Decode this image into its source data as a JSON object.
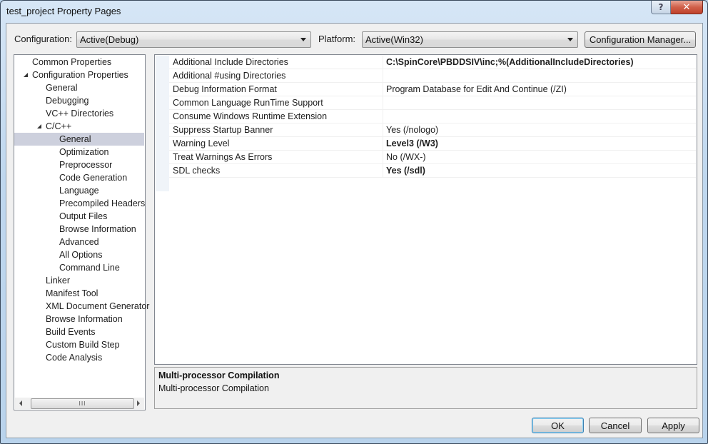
{
  "window": {
    "title": "test_project Property Pages",
    "help_button": "?",
    "close_button": "✕"
  },
  "toolbar": {
    "configuration_label": "Configuration:",
    "configuration_value": "Active(Debug)",
    "platform_label": "Platform:",
    "platform_value": "Active(Win32)",
    "config_manager_label": "Configuration Manager..."
  },
  "tree": {
    "items": [
      {
        "label": "Common Properties",
        "level": 0,
        "expander": "closed"
      },
      {
        "label": "Configuration Properties",
        "level": 0,
        "expander": "open"
      },
      {
        "label": "General",
        "level": 1,
        "expander": "none"
      },
      {
        "label": "Debugging",
        "level": 1,
        "expander": "none"
      },
      {
        "label": "VC++ Directories",
        "level": 1,
        "expander": "none"
      },
      {
        "label": "C/C++",
        "level": 1,
        "expander": "open"
      },
      {
        "label": "General",
        "level": 2,
        "expander": "none",
        "selected": true
      },
      {
        "label": "Optimization",
        "level": 2,
        "expander": "none"
      },
      {
        "label": "Preprocessor",
        "level": 2,
        "expander": "none"
      },
      {
        "label": "Code Generation",
        "level": 2,
        "expander": "none"
      },
      {
        "label": "Language",
        "level": 2,
        "expander": "none"
      },
      {
        "label": "Precompiled Headers",
        "level": 2,
        "expander": "none"
      },
      {
        "label": "Output Files",
        "level": 2,
        "expander": "none"
      },
      {
        "label": "Browse Information",
        "level": 2,
        "expander": "none"
      },
      {
        "label": "Advanced",
        "level": 2,
        "expander": "none"
      },
      {
        "label": "All Options",
        "level": 2,
        "expander": "none"
      },
      {
        "label": "Command Line",
        "level": 2,
        "expander": "none"
      },
      {
        "label": "Linker",
        "level": 1,
        "expander": "closed"
      },
      {
        "label": "Manifest Tool",
        "level": 1,
        "expander": "closed"
      },
      {
        "label": "XML Document Generator",
        "level": 1,
        "expander": "closed"
      },
      {
        "label": "Browse Information",
        "level": 1,
        "expander": "closed"
      },
      {
        "label": "Build Events",
        "level": 1,
        "expander": "closed"
      },
      {
        "label": "Custom Build Step",
        "level": 1,
        "expander": "closed"
      },
      {
        "label": "Code Analysis",
        "level": 1,
        "expander": "closed"
      }
    ],
    "scroll_thumb_grip": "III"
  },
  "properties": {
    "rows": [
      {
        "name": "Additional Include Directories",
        "value": "C:\\SpinCore\\PBDDSIV\\inc;%(AdditionalIncludeDirectories)",
        "bold": true
      },
      {
        "name": "Additional #using Directories",
        "value": "",
        "bold": false
      },
      {
        "name": "Debug Information Format",
        "value": "Program Database for Edit And Continue (/ZI)",
        "bold": false
      },
      {
        "name": "Common Language RunTime Support",
        "value": "",
        "bold": false
      },
      {
        "name": "Consume Windows Runtime Extension",
        "value": "",
        "bold": false
      },
      {
        "name": "Suppress Startup Banner",
        "value": "Yes (/nologo)",
        "bold": false
      },
      {
        "name": "Warning Level",
        "value": "Level3 (/W3)",
        "bold": true
      },
      {
        "name": "Treat Warnings As Errors",
        "value": "No (/WX-)",
        "bold": false
      },
      {
        "name": "SDL checks",
        "value": "Yes (/sdl)",
        "bold": true
      }
    ]
  },
  "description": {
    "title": "Multi-processor Compilation",
    "text": "Multi-processor Compilation"
  },
  "buttons": {
    "ok": "OK",
    "cancel": "Cancel",
    "apply": "Apply"
  }
}
